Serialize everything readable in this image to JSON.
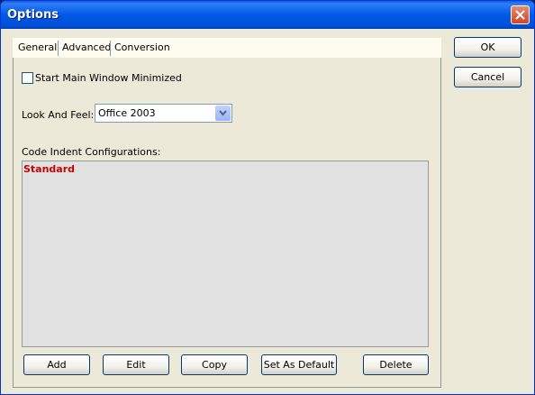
{
  "window": {
    "title": "Options"
  },
  "tabs": [
    {
      "label": "General",
      "active": true
    },
    {
      "label": "Advanced",
      "active": false
    },
    {
      "label": "Conversion",
      "active": false
    }
  ],
  "general": {
    "start_minimized_label": "Start Main Window Minimized",
    "start_minimized_checked": false,
    "look_and_feel_label": "Look And Feel:",
    "look_and_feel_value": "Office 2003",
    "code_indent_label": "Code Indent Configurations:",
    "code_indent_items": [
      "Standard"
    ],
    "item_color": "#CC0000"
  },
  "buttons": {
    "ok": "OK",
    "cancel": "Cancel",
    "add": "Add",
    "edit": "Edit",
    "copy": "Copy",
    "set_as_default": "Set As Default",
    "delete": "Delete"
  }
}
